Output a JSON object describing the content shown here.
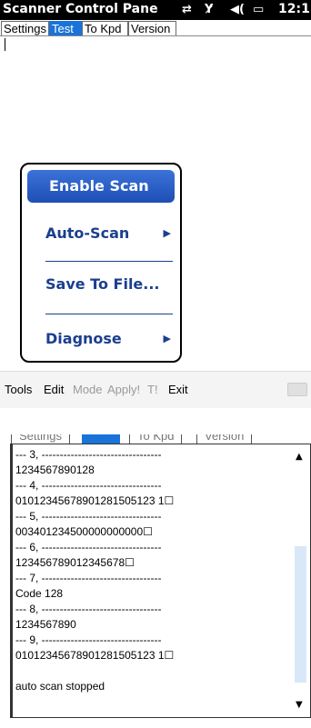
{
  "statusbar": {
    "title": "Scanner Control Pane",
    "time": "12:12",
    "icons": [
      "sync-icon",
      "no-signal-icon",
      "volume-icon",
      "battery-icon"
    ]
  },
  "tabs": [
    {
      "label": "Settings",
      "active": false
    },
    {
      "label": "Test",
      "active": true
    },
    {
      "label": "To Kpd",
      "active": false
    },
    {
      "label": "Version",
      "active": false
    }
  ],
  "popup_menu": {
    "items": [
      {
        "label": "Enable Scan",
        "selected": true,
        "submenu": false
      },
      {
        "label": "Auto-Scan",
        "selected": false,
        "submenu": true
      },
      {
        "label": "Save To File...",
        "selected": false,
        "submenu": false
      },
      {
        "label": "Diagnose",
        "selected": false,
        "submenu": true
      }
    ]
  },
  "toolbar": {
    "items": [
      {
        "label": "Tools",
        "enabled": true
      },
      {
        "label": "Edit",
        "enabled": true
      },
      {
        "label": "Mode",
        "enabled": false
      },
      {
        "label": "Apply!",
        "enabled": false
      },
      {
        "label": "T!",
        "enabled": false
      },
      {
        "label": "Exit",
        "enabled": true
      }
    ]
  },
  "lower_tabs": [
    {
      "label": "Settings",
      "active": false
    },
    {
      "label": "Test",
      "active": true
    },
    {
      "label": "To Kpd",
      "active": false
    },
    {
      "label": "Version",
      "active": false
    }
  ],
  "scan_log": {
    "lines": [
      "--- 3, ---------------------------------",
      "1234567890128",
      "--- 4, ---------------------------------",
      "01012345678901281505123 1☐",
      "--- 5, ---------------------------------",
      "003401234500000000000☐",
      "--- 6, ---------------------------------",
      "123456789012345678☐",
      "--- 7, ---------------------------------",
      "Code 128",
      "--- 8, ---------------------------------",
      "1234567890",
      "--- 9, ---------------------------------",
      "01012345678901281505123 1☐",
      "",
      "auto scan stopped"
    ]
  },
  "colors": {
    "title_bg": "#000000",
    "active_tab": "#1a73d8",
    "menu_text": "#1b3f8f",
    "menu_selected": "#2a5fc8"
  }
}
